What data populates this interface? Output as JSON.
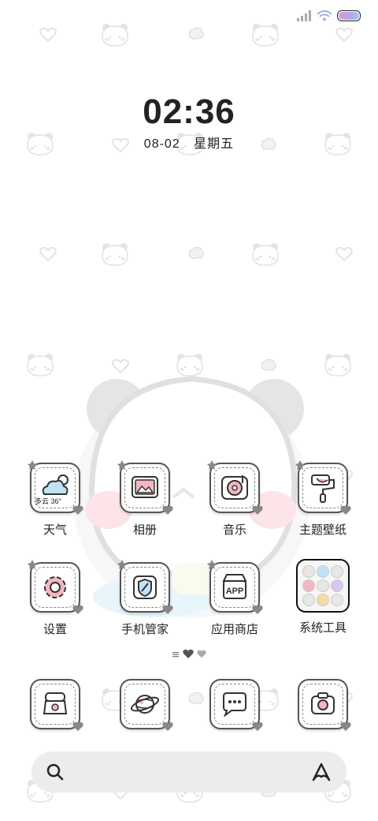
{
  "status_bar": {
    "signal_icon": "signal-icon",
    "wifi_icon": "wifi-icon",
    "battery_icon": "battery-icon"
  },
  "clock": {
    "time": "02:36",
    "date": "08-02",
    "weekday": "星期五"
  },
  "apps": [
    {
      "id": "weather",
      "label": "天气",
      "icon": "weather-icon",
      "info": "多云 36°"
    },
    {
      "id": "gallery",
      "label": "相册",
      "icon": "gallery-icon"
    },
    {
      "id": "music",
      "label": "音乐",
      "icon": "music-icon"
    },
    {
      "id": "themes",
      "label": "主题壁纸",
      "icon": "paint-roller-icon"
    },
    {
      "id": "settings",
      "label": "设置",
      "icon": "gear-icon"
    },
    {
      "id": "phone_manager",
      "label": "手机管家",
      "icon": "shield-icon"
    },
    {
      "id": "app_store",
      "label": "应用商店",
      "icon": "app-store-icon"
    },
    {
      "id": "system_tools",
      "label": "系统工具",
      "icon": "folder-icon"
    }
  ],
  "dock": [
    {
      "id": "phone",
      "icon": "phone-icon"
    },
    {
      "id": "browser",
      "icon": "globe-icon"
    },
    {
      "id": "messages",
      "icon": "chat-icon"
    },
    {
      "id": "camera",
      "icon": "camera-icon"
    }
  ],
  "page_indicator": {
    "pages": 3,
    "current": 1
  },
  "search_bar": {
    "search_icon": "search-icon",
    "assistant_icon": "assistant-icon"
  },
  "colors": {
    "outline": "#555555",
    "background": "#ffffff",
    "search_bg": "#ececec",
    "accent_pink": "#f4b6c2",
    "accent_blue": "#bfe3f5"
  }
}
